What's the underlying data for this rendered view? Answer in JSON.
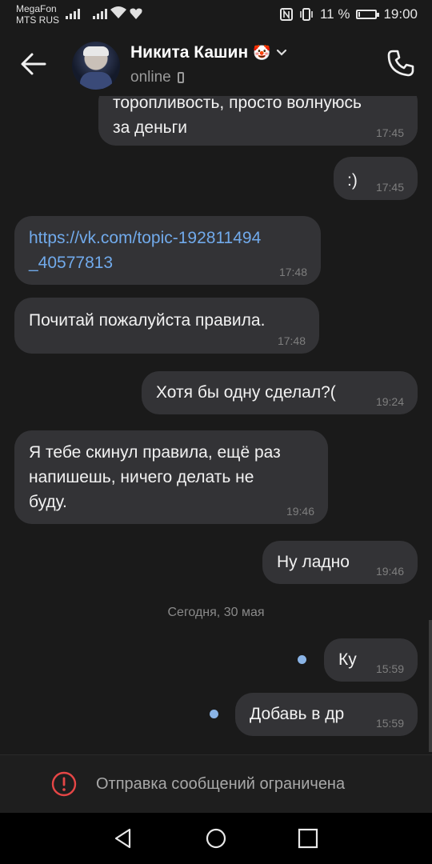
{
  "status_bar": {
    "carrier_1": "MegaFon",
    "carrier_2": "MTS RUS",
    "battery_level": 0.11,
    "battery_text": "11 %",
    "time": "19:00",
    "icons": [
      "signal-icon",
      "signal-icon",
      "wifi-icon",
      "heart-icon",
      "nfc-icon",
      "vibrate-icon",
      "battery-icon"
    ]
  },
  "header": {
    "contact_name": "Никита Кашин",
    "name_emoji": "🤡",
    "status": "online",
    "icons": [
      "back-arrow-icon",
      "chevron-down-icon",
      "mobile-phone-icon",
      "call-icon"
    ]
  },
  "messages": [
    {
      "id": "m1",
      "direction": "out",
      "text_line1": "торопливость, просто волнуюсь",
      "text_line2": "за деньги",
      "time": "17:45"
    },
    {
      "id": "m2",
      "direction": "out",
      "text": ":)",
      "time": "17:45"
    },
    {
      "id": "m3",
      "direction": "in",
      "text_line1": "https://vk.com/topic-192811494",
      "text_line2": "_40577813",
      "time": "17:48",
      "is_link": true
    },
    {
      "id": "m4",
      "direction": "in",
      "text": "Почитай пожалуйста правила.",
      "time": "17:48"
    },
    {
      "id": "m5",
      "direction": "out",
      "text": "Хотя бы одну сделал?(",
      "time": "19:24"
    },
    {
      "id": "m6",
      "direction": "in",
      "text_line1": "Я тебе скинул правила, ещё раз",
      "text_line2": "напишешь, ничего делать не",
      "text_line3": "буду.",
      "time": "19:46"
    },
    {
      "id": "m7",
      "direction": "out",
      "text": "Ну ладно",
      "time": "19:46"
    },
    {
      "id": "m8",
      "direction": "out",
      "text": "Ку",
      "time": "15:59",
      "unread": true
    },
    {
      "id": "m9",
      "direction": "out",
      "text": "Добавь в др",
      "time": "15:59",
      "unread": true
    }
  ],
  "date_separator": "Сегодня, 30 мая",
  "restriction": {
    "text": "Отправка сообщений ограничена",
    "icon": "warning-icon",
    "color": "#e64646"
  },
  "navbar": {
    "icons": [
      "nav-back-icon",
      "nav-home-icon",
      "nav-recents-icon"
    ]
  },
  "colors": {
    "background": "#1a1a1a",
    "bubble": "#333336",
    "link": "#71aaeb",
    "unread_dot": "#8ab4e6"
  }
}
